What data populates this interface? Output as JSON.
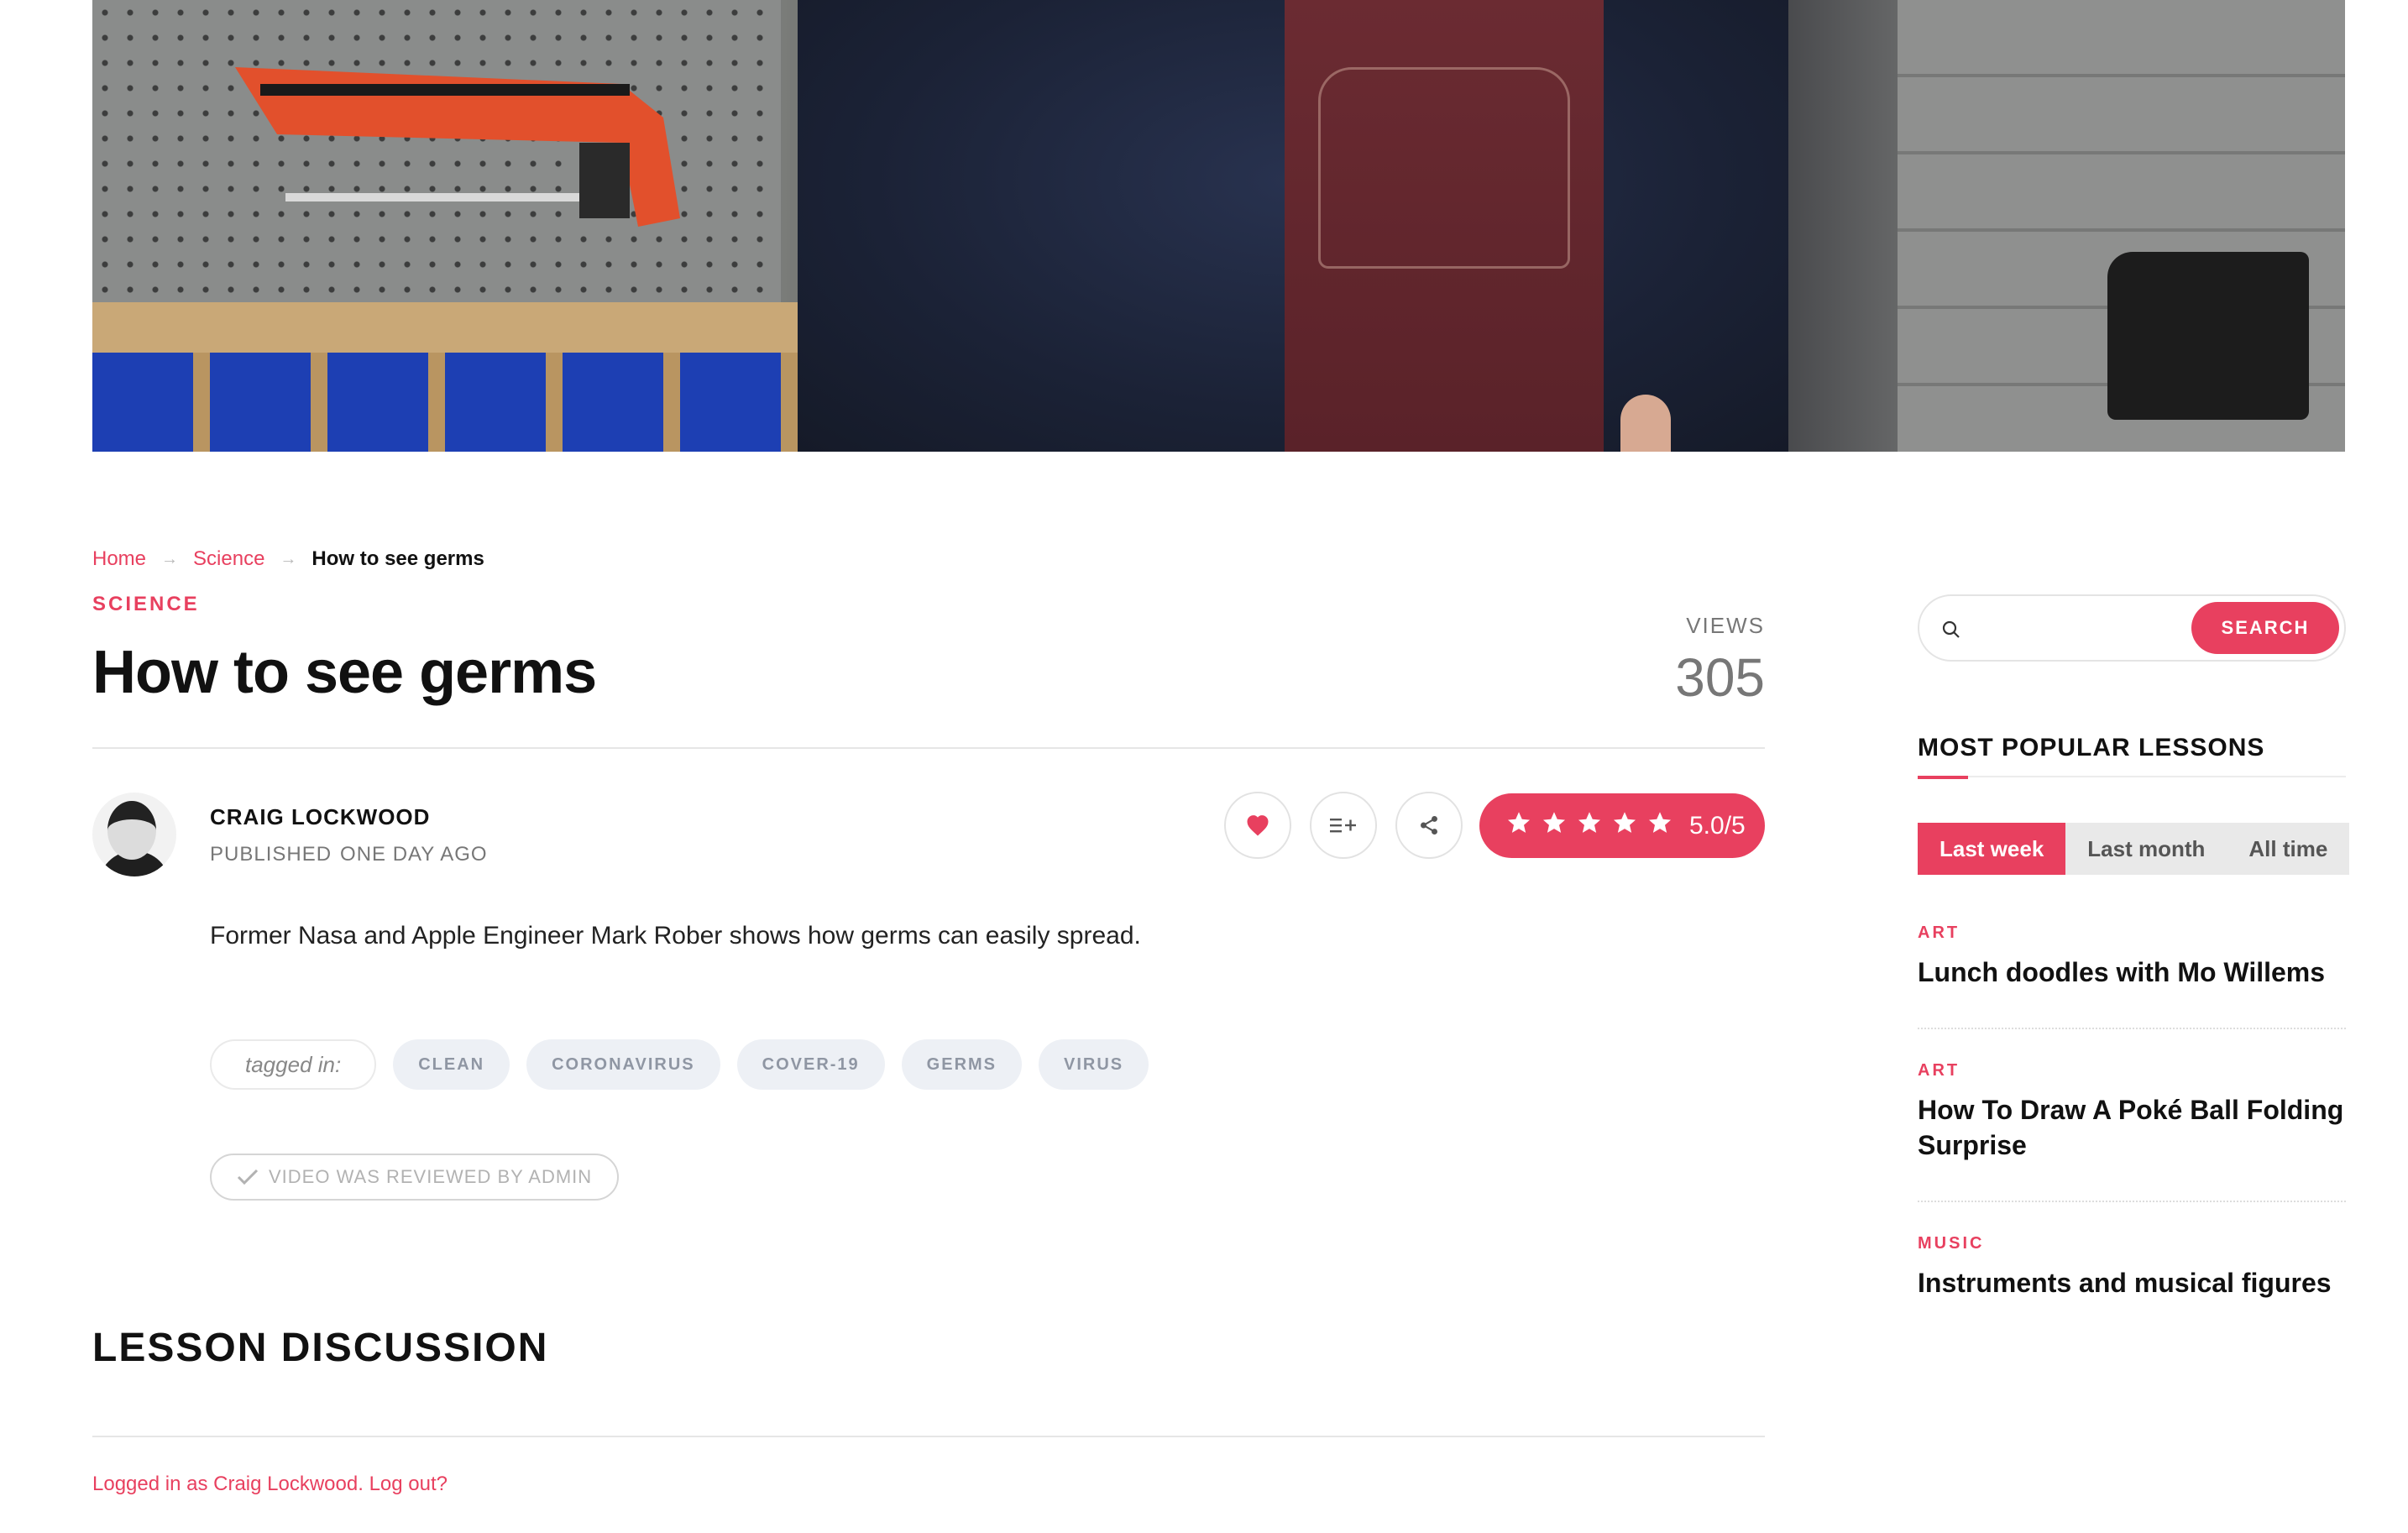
{
  "breadcrumb": {
    "home": "Home",
    "science": "Science",
    "current": "How to see germs"
  },
  "lesson": {
    "category": "SCIENCE",
    "title": "How to see germs",
    "views_label": "VIEWS",
    "views_count": "305",
    "author": "CRAIG LOCKWOOD",
    "published_label": "PUBLISHED",
    "published_when": "ONE DAY AGO",
    "rating": "5.0/5",
    "rating_stars": 5,
    "description": "Former Nasa and Apple Engineer Mark Rober shows how germs can easily spread.",
    "tagged_label": "tagged in:",
    "tags": [
      "CLEAN",
      "CORONAVIRUS",
      "COVER-19",
      "GERMS",
      "VIRUS"
    ],
    "reviewed": "VIDEO WAS REVIEWED BY ADMIN"
  },
  "discussion": {
    "heading": "LESSON DISCUSSION",
    "logged_in": "Logged in as Craig Lockwood",
    "logout": "Log out?"
  },
  "sidebar": {
    "search_button": "SEARCH",
    "search_value": "",
    "popular_title": "MOST POPULAR LESSONS",
    "filters": [
      "Last week",
      "Last month",
      "All time"
    ],
    "active_filter": "Last week",
    "lessons": [
      {
        "category": "ART",
        "title": "Lunch doodles with Mo Willems"
      },
      {
        "category": "ART",
        "title": "How To Draw A Poké Ball Folding Surprise"
      },
      {
        "category": "MUSIC",
        "title": "Instruments and musical figures"
      }
    ]
  },
  "colors": {
    "accent": "#e8405f",
    "text": "#111111",
    "muted": "#777777",
    "tag_bg": "#edf0f5"
  },
  "icons": [
    "heart-icon",
    "playlist-add-icon",
    "share-icon",
    "star-icon",
    "check-icon",
    "search-icon",
    "arrow-right-icon"
  ]
}
